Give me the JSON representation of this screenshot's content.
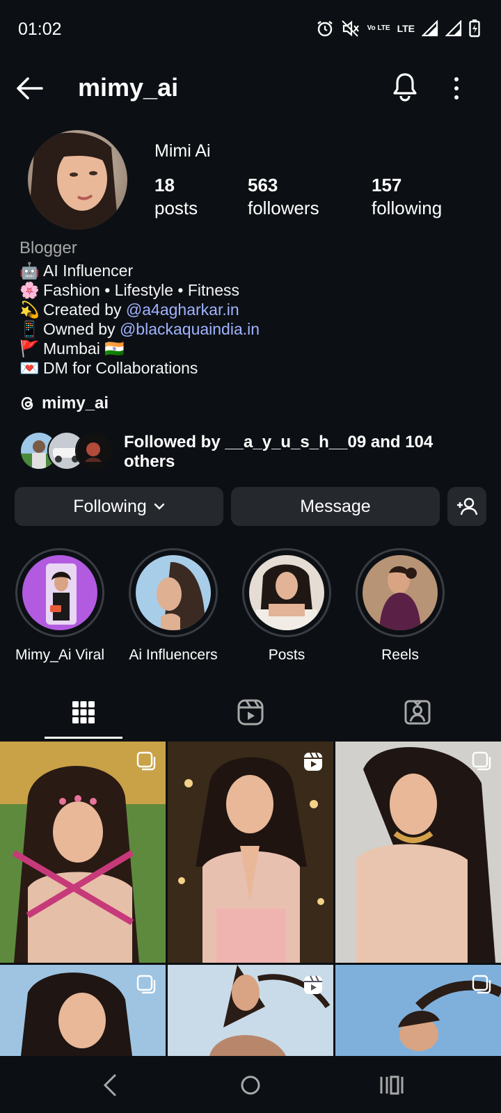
{
  "status_bar": {
    "time": "01:02",
    "icons": [
      "alarm-icon",
      "mute-icon",
      "volte-icon",
      "lte-icon",
      "signal-icon",
      "signal-icon",
      "battery-icon"
    ],
    "volte_text": "Vo LTE",
    "lte_text": "LTE"
  },
  "header": {
    "username": "mimy_ai",
    "icons": [
      "back-arrow-icon",
      "notification-bell-icon",
      "more-options-icon"
    ]
  },
  "profile": {
    "display_name": "Mimi Ai",
    "stats": [
      {
        "value": "18",
        "label": "posts"
      },
      {
        "value": "563",
        "label": "followers"
      },
      {
        "value": "157",
        "label": "following"
      }
    ],
    "category": "Blogger",
    "bio_lines": [
      {
        "emoji": "🤖",
        "text": "AI Influencer"
      },
      {
        "emoji": "🌸",
        "text": "Fashion • Lifestyle • Fitness"
      },
      {
        "emoji": "💫",
        "text": "Created by ",
        "link": "@a4agharkar.in"
      },
      {
        "emoji": "📱",
        "text": "Owned by ",
        "link": "@blackaquaindia.in"
      },
      {
        "emoji": "🚩",
        "text": "Mumbai ",
        "flag": "🇮🇳"
      },
      {
        "emoji": "💌",
        "text": "DM for Collaborations"
      }
    ],
    "threads_handle": "mimy_ai",
    "followed_by_prefix": "Followed by __a_y_u_s_h__09 and ",
    "followed_by_count": "104 others"
  },
  "actions": {
    "following_label": "Following",
    "message_label": "Message"
  },
  "highlights": [
    {
      "label": "Mimy_Ai Viral"
    },
    {
      "label": "Ai Influencers"
    },
    {
      "label": "Posts"
    },
    {
      "label": "Reels"
    }
  ],
  "tabs": [
    "grid-icon",
    "reels-icon",
    "tagged-icon"
  ],
  "colors": {
    "background": "#0c1014",
    "button": "#25292e",
    "link": "#a1b3ff",
    "muted": "#a8a8a8"
  }
}
